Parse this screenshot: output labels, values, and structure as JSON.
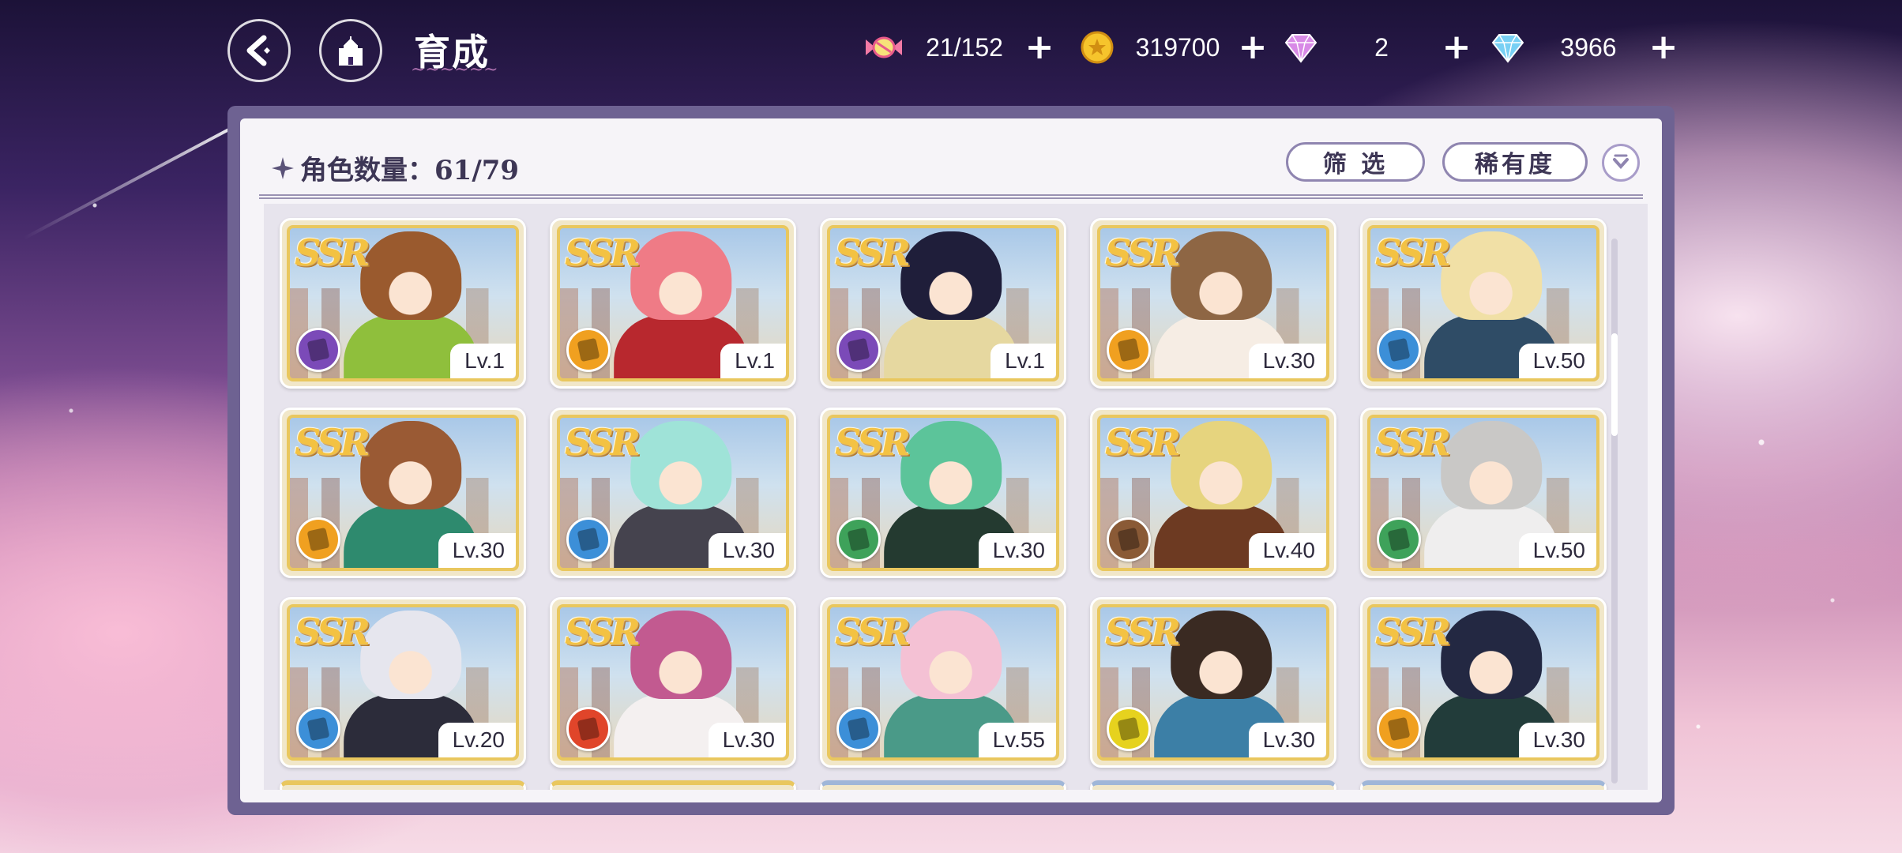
{
  "header": {
    "back_label": "back",
    "home_label": "home",
    "title": "育成",
    "currencies": [
      {
        "id": "candy",
        "icon": "candy-icon",
        "value": "21/152",
        "color": "#e85a8a"
      },
      {
        "id": "gold",
        "icon": "gold-coin-icon",
        "value": "319700",
        "color": "#f2b81e"
      },
      {
        "id": "paid-gem",
        "icon": "pink-diamond-icon",
        "value": "2",
        "color": "#c77be6"
      },
      {
        "id": "gem",
        "icon": "blue-diamond-icon",
        "value": "3966",
        "color": "#6cc7f0"
      }
    ]
  },
  "panel": {
    "count_label": "角色数量：61/79",
    "filter_label": "筛 选",
    "rarity_label": "稀有度"
  },
  "cards": [
    {
      "rarity": "SSR",
      "level": "Lv.1",
      "element": "purple",
      "element_color": "#7b4ab8",
      "hair": "#9a5a2e",
      "outfit": "#8fbf3c"
    },
    {
      "rarity": "SSR",
      "level": "Lv.1",
      "element": "orange",
      "element_color": "#f0a020",
      "hair": "#ef7b86",
      "outfit": "#b8282e"
    },
    {
      "rarity": "SSR",
      "level": "Lv.1",
      "element": "purple",
      "element_color": "#7b4ab8",
      "hair": "#1f1e3a",
      "outfit": "#e6d8a0"
    },
    {
      "rarity": "SSR",
      "level": "Lv.30",
      "element": "orange",
      "element_color": "#f0a020",
      "hair": "#8e6644",
      "outfit": "#f6ede4"
    },
    {
      "rarity": "SSR",
      "level": "Lv.50",
      "element": "blue",
      "element_color": "#3c8fd8",
      "hair": "#f1e0a6",
      "outfit": "#2f4c66"
    },
    {
      "rarity": "SSR",
      "level": "Lv.30",
      "element": "orange",
      "element_color": "#f0a020",
      "hair": "#9a5a34",
      "outfit": "#2e8a6e"
    },
    {
      "rarity": "SSR",
      "level": "Lv.30",
      "element": "blue",
      "element_color": "#3c8fd8",
      "hair": "#9fe3d8",
      "outfit": "#45434e"
    },
    {
      "rarity": "SSR",
      "level": "Lv.30",
      "element": "green",
      "element_color": "#3ea25a",
      "hair": "#5cc49a",
      "outfit": "#243a30"
    },
    {
      "rarity": "SSR",
      "level": "Lv.40",
      "element": "brown",
      "element_color": "#8a5a36",
      "hair": "#e6d47e",
      "outfit": "#6d3a22"
    },
    {
      "rarity": "SSR",
      "level": "Lv.50",
      "element": "green",
      "element_color": "#3ea25a",
      "hair": "#c9c8c6",
      "outfit": "#efeeee"
    },
    {
      "rarity": "SSR",
      "level": "Lv.20",
      "element": "blue",
      "element_color": "#3c8fd8",
      "hair": "#e6e6ee",
      "outfit": "#2c2c3a"
    },
    {
      "rarity": "SSR",
      "level": "Lv.30",
      "element": "red",
      "element_color": "#e0452a",
      "hair": "#c25a90",
      "outfit": "#f4f0f0"
    },
    {
      "rarity": "SSR",
      "level": "Lv.55",
      "element": "blue",
      "element_color": "#3c8fd8",
      "hair": "#f4c1d4",
      "outfit": "#4a9a88"
    },
    {
      "rarity": "SSR",
      "level": "Lv.30",
      "element": "yellow",
      "element_color": "#e6d21e",
      "hair": "#3a2a22",
      "outfit": "#3c7fa6"
    },
    {
      "rarity": "SSR",
      "level": "Lv.30",
      "element": "orange",
      "element_color": "#f0a020",
      "hair": "#232842",
      "outfit": "#223c3a"
    }
  ],
  "partial_row_count": 5
}
